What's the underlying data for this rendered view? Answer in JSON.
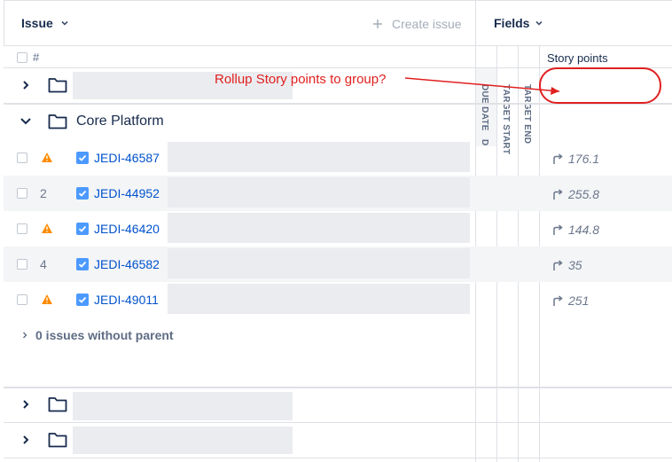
{
  "header": {
    "issue_label": "Issue",
    "create_issue_label": "Create issue",
    "fields_label": "Fields"
  },
  "column_headers": {
    "hash": "#",
    "story_points": "Story points",
    "due_date": "DUE DATE",
    "due_date_extra": "D",
    "target_start": "TARGET START",
    "target_end": "TARGET END"
  },
  "annotation": {
    "text": "Rollup Story points to group?",
    "color": "#e02020"
  },
  "groups": [
    {
      "name": "",
      "expanded": false
    },
    {
      "name": "Core Platform",
      "expanded": true
    },
    {
      "name": "",
      "expanded": false
    },
    {
      "name": "",
      "expanded": false
    }
  ],
  "issues": [
    {
      "rank": "",
      "warning": true,
      "key": "JEDI-46587",
      "story_points": "176.1"
    },
    {
      "rank": "2",
      "warning": false,
      "key": "JEDI-44952",
      "story_points": "255.8"
    },
    {
      "rank": "",
      "warning": true,
      "key": "JEDI-46420",
      "story_points": "144.8"
    },
    {
      "rank": "4",
      "warning": false,
      "key": "JEDI-46582",
      "story_points": "35"
    },
    {
      "rank": "",
      "warning": true,
      "key": "JEDI-49011",
      "story_points": "251"
    }
  ],
  "without_parent_label": "0 issues without parent",
  "colors": {
    "link": "#0052cc",
    "warning": "#ff8b00",
    "type_checkbox": "#4c9aff",
    "annotation": "#e02020"
  }
}
